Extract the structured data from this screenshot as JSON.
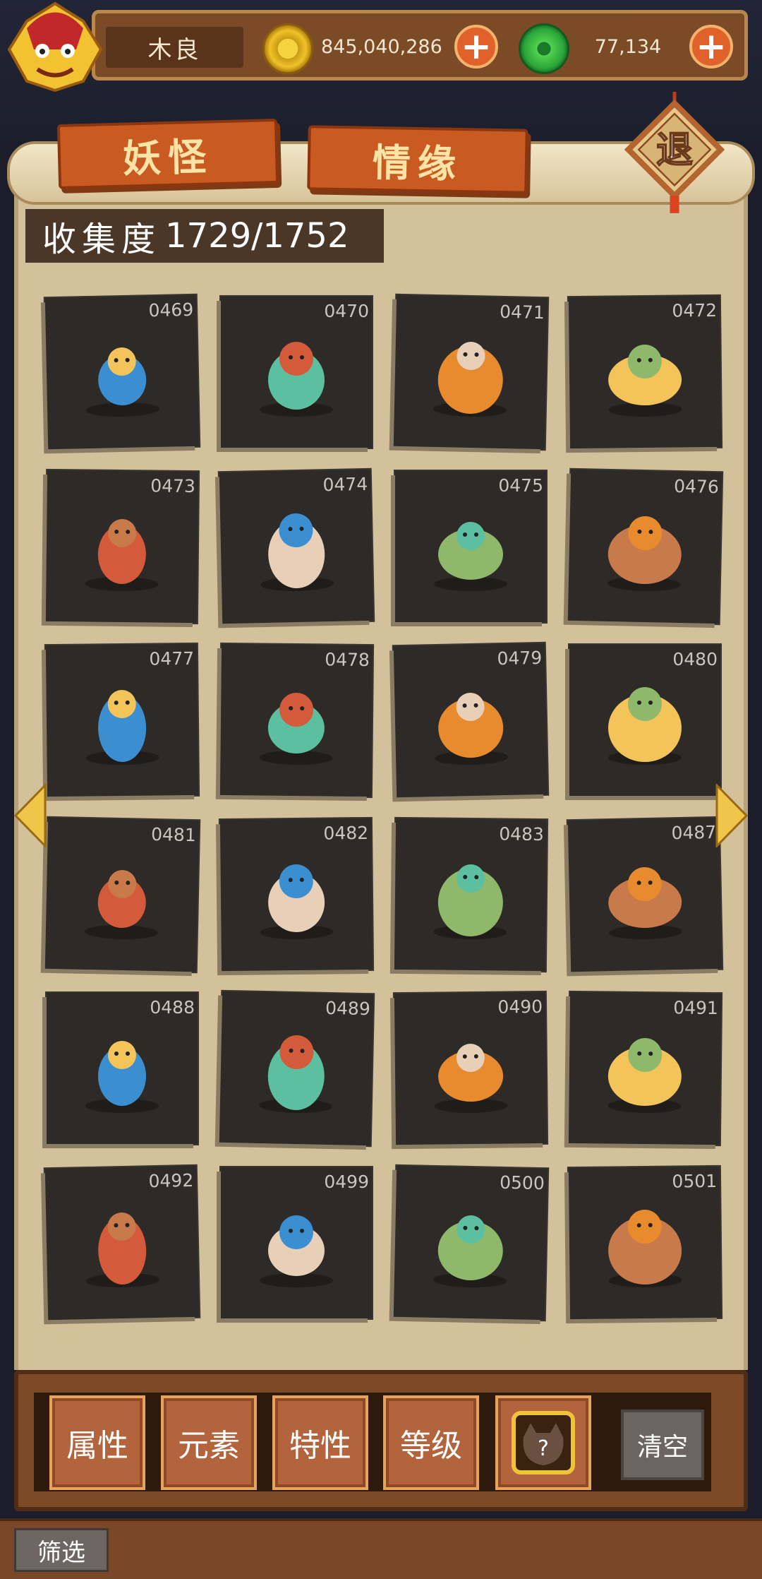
{
  "player": {
    "name": "木良"
  },
  "currency": {
    "gold": "845,040,286",
    "jade": "77,134",
    "add_symbol": "+"
  },
  "tabs": [
    {
      "label": "妖怪",
      "active": true
    },
    {
      "label": "情缘",
      "active": false
    }
  ],
  "exit_label": "退",
  "collection": {
    "label": "收集度",
    "progress": "1729/1752"
  },
  "cards": [
    {
      "number": "0469",
      "icon": "blue-water-blob-monster"
    },
    {
      "number": "0470",
      "icon": "blue-green-imp-monster"
    },
    {
      "number": "0471",
      "icon": "water-dragon-warrior-monster"
    },
    {
      "number": "0472",
      "icon": "orange-flame-spirit-monster"
    },
    {
      "number": "0473",
      "icon": "campfire-fish-roast-monster"
    },
    {
      "number": "0474",
      "icon": "fire-dragon-king-monster"
    },
    {
      "number": "0475",
      "icon": "lotus-leaf-umbrella-monster"
    },
    {
      "number": "0476",
      "icon": "balloon-cat-monster"
    },
    {
      "number": "0477",
      "icon": "umbrella-dragon-elder-monster"
    },
    {
      "number": "0478",
      "icon": "tiny-scarecrow-monster"
    },
    {
      "number": "0479",
      "icon": "green-fish-scholar-monster"
    },
    {
      "number": "0480",
      "icon": "ice-cart-chef-monster"
    },
    {
      "number": "0481",
      "icon": "white-fox-curled-monster"
    },
    {
      "number": "0482",
      "icon": "fox-girl-monster"
    },
    {
      "number": "0483",
      "icon": "fox-queen-monster"
    },
    {
      "number": "0487",
      "icon": "grey-stone-blob-monster"
    },
    {
      "number": "0488",
      "icon": "black-crow-monster"
    },
    {
      "number": "0489",
      "icon": "grey-official-monster"
    },
    {
      "number": "0490",
      "icon": "tofu-cream-monster"
    },
    {
      "number": "0491",
      "icon": "bun-chick-monster"
    },
    {
      "number": "0492",
      "icon": "yellow-ox-gambler-monster"
    },
    {
      "number": "0499",
      "icon": "dumpling-chopsticks-monster"
    },
    {
      "number": "0500",
      "icon": "lady-in-pink-monster"
    },
    {
      "number": "0501",
      "icon": "golden-empress-monster"
    }
  ],
  "filters": {
    "buttons": [
      "属性",
      "元素",
      "特性",
      "等级"
    ],
    "unknown_symbol": "?",
    "clear": "清空",
    "title": "筛选"
  },
  "colors": {
    "tab_active": "#c95a21",
    "panel": "#d3c19b",
    "card_bg": "#2d2a27"
  }
}
